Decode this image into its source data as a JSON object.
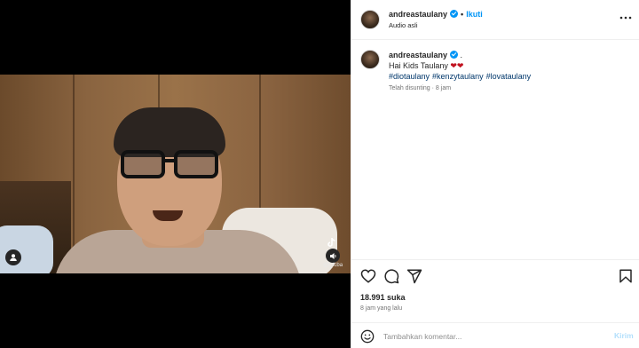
{
  "post": {
    "username": "andreastaulany",
    "follow_label": "Ikuti",
    "audio_label": "Audio asli",
    "separator": "•"
  },
  "caption": {
    "username": "andreastaulany",
    "trailing": ".",
    "text": "Hai Kids Taulany",
    "hearts": "❤❤",
    "hashtags": [
      "#diotaulany",
      "#kenzytaulany",
      "#lovataulany"
    ],
    "meta": "Telah disunting · 8 jam"
  },
  "stats": {
    "likes": "18.991 suka",
    "time_ago": "8 jam yang lalu"
  },
  "comment": {
    "placeholder": "Tambahkan komentar...",
    "send_label": "Kirim"
  },
  "video": {
    "watermark": "@l_tcba",
    "brand_mark": "ok"
  },
  "icons": {
    "header_more": "more-horizontal-icon",
    "like": "heart-icon",
    "comment": "comment-icon",
    "share": "share-icon",
    "save": "bookmark-icon",
    "emoji": "emoji-icon",
    "mute": "speaker-icon",
    "tagged": "user-icon"
  },
  "colors": {
    "accent": "#0095f6",
    "hashtag": "#00376b",
    "muted": "#737373",
    "heart": "#c1121f"
  }
}
